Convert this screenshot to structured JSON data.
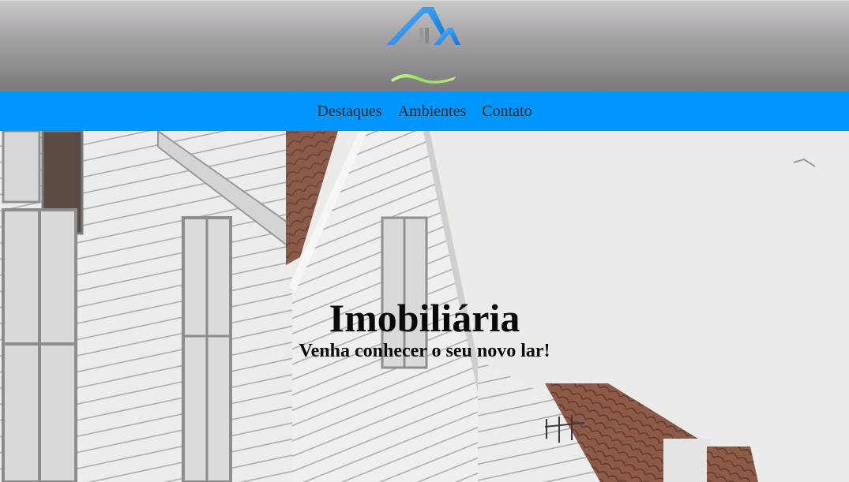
{
  "header": {
    "logo_icon": "house-roof-logo-icon",
    "accent_colors": {
      "roof_blue": "#1f8ef0",
      "wave_green": "#8fe35a"
    }
  },
  "nav": {
    "background": "#0096ff",
    "items": [
      {
        "label": "Destaques"
      },
      {
        "label": "Ambientes"
      },
      {
        "label": "Contato"
      }
    ]
  },
  "hero": {
    "title": "Imobiliária",
    "subtitle": "Venha conhecer o seu novo lar!",
    "background_image": "white-wooden-houses-photo"
  }
}
